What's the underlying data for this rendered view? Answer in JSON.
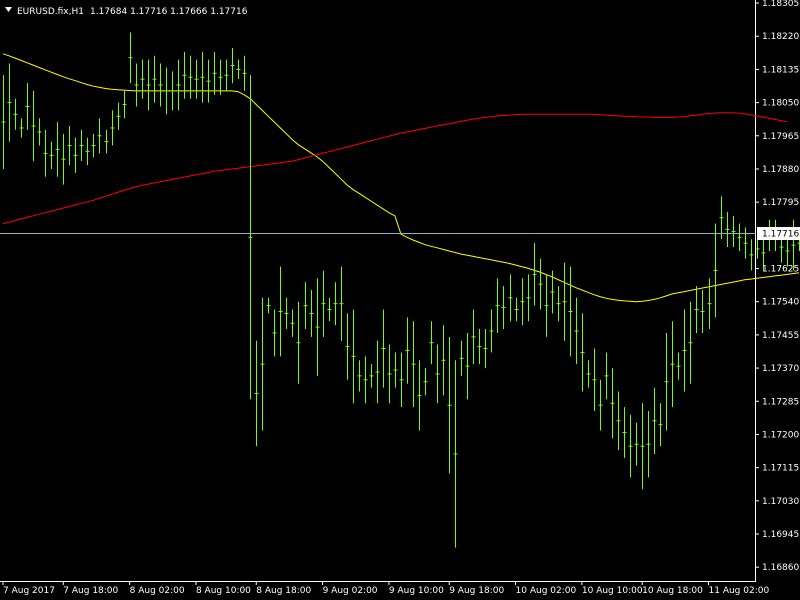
{
  "header": {
    "symbol": "EURUSD.fix,H1",
    "ohlc": "1.17684 1.17716 1.17666 1.17716"
  },
  "colors": {
    "background": "#000000",
    "bars": "#7CFC00",
    "fast_ma": "#ffff00",
    "slow_ma": "#ff0000",
    "bid_line": "#8fb4c8",
    "text": "#ffffff"
  },
  "chart_data": {
    "type": "line",
    "title": "EURUSD.fix,H1",
    "xlabel": "",
    "ylabel": "",
    "ylim": [
      1.1684,
      1.183
    ],
    "grid": false,
    "current_price": "1.17716",
    "y_ticks": [
      "1.18305",
      "1.18220",
      "1.18135",
      "1.18050",
      "1.17965",
      "1.17880",
      "1.17795",
      "1.17625",
      "1.17540",
      "1.17455",
      "1.17370",
      "1.17285",
      "1.17200",
      "1.17115",
      "1.17030",
      "1.16945",
      "1.16860"
    ],
    "x_ticks": [
      {
        "label": "7 Aug 2017",
        "i": 0
      },
      {
        "label": "7 Aug 18:00",
        "i": 10
      },
      {
        "label": "8 Aug 02:00",
        "i": 21
      },
      {
        "label": "8 Aug 10:00",
        "i": 32
      },
      {
        "label": "8 Aug 18:00",
        "i": 42
      },
      {
        "label": "9 Aug 02:00",
        "i": 53
      },
      {
        "label": "9 Aug 10:00",
        "i": 64
      },
      {
        "label": "9 Aug 18:00",
        "i": 74
      },
      {
        "label": "10 Aug 02:00",
        "i": 85
      },
      {
        "label": "10 Aug 10:00",
        "i": 96
      },
      {
        "label": "10 Aug 18:00",
        "i": 106
      },
      {
        "label": "11 Aug 02:00",
        "i": 117
      }
    ],
    "bars": [
      [
        1.1812,
        1.1788
      ],
      [
        1.1815,
        1.1795
      ],
      [
        1.1806,
        1.1798
      ],
      [
        1.1801,
        1.1796
      ],
      [
        1.181,
        1.1798
      ],
      [
        1.1808,
        1.179
      ],
      [
        1.1801,
        1.1794
      ],
      [
        1.1798,
        1.1786
      ],
      [
        1.1795,
        1.1788
      ],
      [
        1.18,
        1.1786
      ],
      [
        1.1797,
        1.1784
      ],
      [
        1.1799,
        1.1789
      ],
      [
        1.1796,
        1.1787
      ],
      [
        1.1798,
        1.179
      ],
      [
        1.1796,
        1.1789
      ],
      [
        1.1797,
        1.1791
      ],
      [
        1.1801,
        1.1792
      ],
      [
        1.1798,
        1.1792
      ],
      [
        1.1803,
        1.1794
      ],
      [
        1.1805,
        1.1798
      ],
      [
        1.1808,
        1.1801
      ],
      [
        1.1823,
        1.181
      ],
      [
        1.1815,
        1.1804
      ],
      [
        1.1816,
        1.1806
      ],
      [
        1.1816,
        1.1803
      ],
      [
        1.1817,
        1.1805
      ],
      [
        1.1815,
        1.1804
      ],
      [
        1.1814,
        1.1802
      ],
      [
        1.1813,
        1.1803
      ],
      [
        1.1816,
        1.1803
      ],
      [
        1.1818,
        1.1806
      ],
      [
        1.1817,
        1.1806
      ],
      [
        1.1816,
        1.1806
      ],
      [
        1.1818,
        1.1805
      ],
      [
        1.1816,
        1.1805
      ],
      [
        1.1818,
        1.1807
      ],
      [
        1.1816,
        1.1807
      ],
      [
        1.1816,
        1.1808
      ],
      [
        1.1819,
        1.181
      ],
      [
        1.1816,
        1.1811
      ],
      [
        1.1817,
        1.1808
      ],
      [
        1.1812,
        1.1729
      ],
      [
        1.1744,
        1.1717
      ],
      [
        1.1755,
        1.1721
      ],
      [
        1.1755,
        1.1751
      ],
      [
        1.1752,
        1.174
      ],
      [
        1.1763,
        1.174
      ],
      [
        1.1755,
        1.1747
      ],
      [
        1.1752,
        1.1745
      ],
      [
        1.1754,
        1.1733
      ],
      [
        1.1759,
        1.1747
      ],
      [
        1.1757,
        1.1745
      ],
      [
        1.176,
        1.1735
      ],
      [
        1.1762,
        1.1745
      ],
      [
        1.1755,
        1.1749
      ],
      [
        1.1759,
        1.1748
      ],
      [
        1.1763,
        1.1744
      ],
      [
        1.1751,
        1.1734
      ],
      [
        1.1752,
        1.1728
      ],
      [
        1.1739,
        1.1731
      ],
      [
        1.174,
        1.1728
      ],
      [
        1.1738,
        1.1732
      ],
      [
        1.1744,
        1.1728
      ],
      [
        1.1752,
        1.1732
      ],
      [
        1.1743,
        1.1728
      ],
      [
        1.1741,
        1.1732
      ],
      [
        1.1741,
        1.1727
      ],
      [
        1.175,
        1.1733
      ],
      [
        1.1749,
        1.1727
      ],
      [
        1.1739,
        1.1721
      ],
      [
        1.1737,
        1.173
      ],
      [
        1.1749,
        1.1738
      ],
      [
        1.1743,
        1.1728
      ],
      [
        1.1748,
        1.173
      ],
      [
        1.1745,
        1.171
      ],
      [
        1.1739,
        1.1691
      ],
      [
        1.1744,
        1.1735
      ],
      [
        1.1746,
        1.1729
      ],
      [
        1.1752,
        1.1738
      ],
      [
        1.1747,
        1.1738
      ],
      [
        1.1747,
        1.1737
      ],
      [
        1.1752,
        1.1741
      ],
      [
        1.176,
        1.1746
      ],
      [
        1.1758,
        1.1747
      ],
      [
        1.1761,
        1.1749
      ],
      [
        1.1755,
        1.1749
      ],
      [
        1.176,
        1.1748
      ],
      [
        1.1761,
        1.1749
      ],
      [
        1.1769,
        1.1753
      ],
      [
        1.1765,
        1.1752
      ],
      [
        1.1761,
        1.1745
      ],
      [
        1.1762,
        1.1751
      ],
      [
        1.1758,
        1.1749
      ],
      [
        1.1764,
        1.1744
      ],
      [
        1.1763,
        1.174
      ],
      [
        1.1755,
        1.1738
      ],
      [
        1.1751,
        1.1731
      ],
      [
        1.1739,
        1.1732
      ],
      [
        1.1742,
        1.1726
      ],
      [
        1.1734,
        1.1721
      ],
      [
        1.1741,
        1.1729
      ],
      [
        1.1737,
        1.1719
      ],
      [
        1.1731,
        1.1716
      ],
      [
        1.1727,
        1.1714
      ],
      [
        1.1725,
        1.1709
      ],
      [
        1.1723,
        1.1712
      ],
      [
        1.1728,
        1.1706
      ],
      [
        1.1726,
        1.1709
      ],
      [
        1.1732,
        1.1715
      ],
      [
        1.1728,
        1.1717
      ],
      [
        1.1746,
        1.1721
      ],
      [
        1.1749,
        1.1727
      ],
      [
        1.1741,
        1.1734
      ],
      [
        1.1752,
        1.1731
      ],
      [
        1.1754,
        1.1733
      ],
      [
        1.1758,
        1.1746
      ],
      [
        1.1757,
        1.1746
      ],
      [
        1.176,
        1.1747
      ],
      [
        1.1774,
        1.175
      ],
      [
        1.1781,
        1.177
      ],
      [
        1.1777,
        1.1768
      ],
      [
        1.1776,
        1.1768
      ],
      [
        1.1774,
        1.1767
      ],
      [
        1.1773,
        1.1765
      ],
      [
        1.177,
        1.1762
      ],
      [
        1.177,
        1.1765
      ],
      [
        1.1771,
        1.1762
      ],
      [
        1.1775,
        1.1767
      ],
      [
        1.1775,
        1.1767
      ],
      [
        1.1772,
        1.1764
      ],
      [
        1.1771,
        1.1763
      ],
      [
        1.1775,
        1.1762
      ],
      [
        1.1771,
        1.1767
      ]
    ],
    "series": [
      {
        "values": [
          1.18175,
          1.1817,
          1.18164,
          1.18158,
          1.18152,
          1.18146,
          1.1814,
          1.18134,
          1.18128,
          1.18122,
          1.18116,
          1.18111,
          1.18106,
          1.18101,
          1.18096,
          1.18092,
          1.18089,
          1.18086,
          1.18084,
          1.18083,
          1.18082,
          1.18081,
          1.1808,
          1.1808,
          1.1808,
          1.1808,
          1.1808,
          1.1808,
          1.1808,
          1.1808,
          1.1808,
          1.1808,
          1.1808,
          1.1808,
          1.1808,
          1.1808,
          1.1808,
          1.1808,
          1.1808,
          1.18078,
          1.1807,
          1.1806,
          1.18045,
          1.1803,
          1.18015,
          1.18,
          1.17985,
          1.1797,
          1.17955,
          1.17942,
          1.17932,
          1.17922,
          1.17912,
          1.179,
          1.17885,
          1.1787,
          1.17855,
          1.1784,
          1.17828,
          1.17818,
          1.17808,
          1.17798,
          1.17788,
          1.17778,
          1.17768,
          1.1776,
          1.17713,
          1.17705,
          1.17698,
          1.17692,
          1.17686,
          1.17682,
          1.17678,
          1.17674,
          1.1767,
          1.17666,
          1.17662,
          1.17659,
          1.17656,
          1.17653,
          1.1765,
          1.17647,
          1.17644,
          1.17641,
          1.17638,
          1.17634,
          1.1763,
          1.17626,
          1.17621,
          1.17616,
          1.1761,
          1.17604,
          1.17597,
          1.1759,
          1.17583,
          1.17576,
          1.1757,
          1.17564,
          1.17558,
          1.17553,
          1.17549,
          1.17546,
          1.17544,
          1.17542,
          1.17541,
          1.1754,
          1.17541,
          1.17543,
          1.17546,
          1.1755,
          1.17555,
          1.1756,
          1.17563,
          1.17566,
          1.17569,
          1.17572,
          1.17575,
          1.17578,
          1.17581,
          1.17584,
          1.17587,
          1.1759,
          1.17593,
          1.17596,
          1.17598,
          1.176,
          1.17602,
          1.17604,
          1.17606,
          1.17608,
          1.1761,
          1.17612,
          1.17614
        ]
      },
      {
        "values": [
          1.1774,
          1.17744,
          1.17748,
          1.17752,
          1.17756,
          1.1776,
          1.17764,
          1.17768,
          1.17772,
          1.17776,
          1.1778,
          1.17784,
          1.17788,
          1.17792,
          1.17796,
          1.178,
          1.17805,
          1.1781,
          1.17815,
          1.1782,
          1.17825,
          1.1783,
          1.17834,
          1.17838,
          1.17841,
          1.17844,
          1.17847,
          1.1785,
          1.17853,
          1.17856,
          1.17859,
          1.17862,
          1.17865,
          1.17868,
          1.17871,
          1.17874,
          1.17876,
          1.17878,
          1.1788,
          1.17882,
          1.17884,
          1.17886,
          1.17888,
          1.1789,
          1.17892,
          1.17894,
          1.17896,
          1.17898,
          1.179,
          1.17904,
          1.17908,
          1.17912,
          1.17916,
          1.1792,
          1.17924,
          1.17928,
          1.17932,
          1.17936,
          1.1794,
          1.17944,
          1.17948,
          1.17952,
          1.17956,
          1.1796,
          1.17964,
          1.17968,
          1.17972,
          1.17975,
          1.17978,
          1.17981,
          1.17984,
          1.17987,
          1.1799,
          1.17993,
          1.17996,
          1.17999,
          1.18002,
          1.18005,
          1.18008,
          1.1801,
          1.18012,
          1.18014,
          1.18016,
          1.18017,
          1.18018,
          1.18019,
          1.1802,
          1.1802,
          1.1802,
          1.1802,
          1.1802,
          1.1802,
          1.1802,
          1.1802,
          1.1802,
          1.1802,
          1.1802,
          1.1802,
          1.1802,
          1.18019,
          1.18018,
          1.18017,
          1.18016,
          1.18015,
          1.18015,
          1.18014,
          1.18013,
          1.18013,
          1.18012,
          1.18012,
          1.18012,
          1.18012,
          1.18013,
          1.18014,
          1.18016,
          1.18018,
          1.1802,
          1.18022,
          1.18023,
          1.18024,
          1.18024,
          1.18024,
          1.18023,
          1.18021,
          1.18019,
          1.18016,
          1.18013,
          1.1801,
          1.18007,
          1.18004,
          1.18001
        ]
      }
    ]
  }
}
